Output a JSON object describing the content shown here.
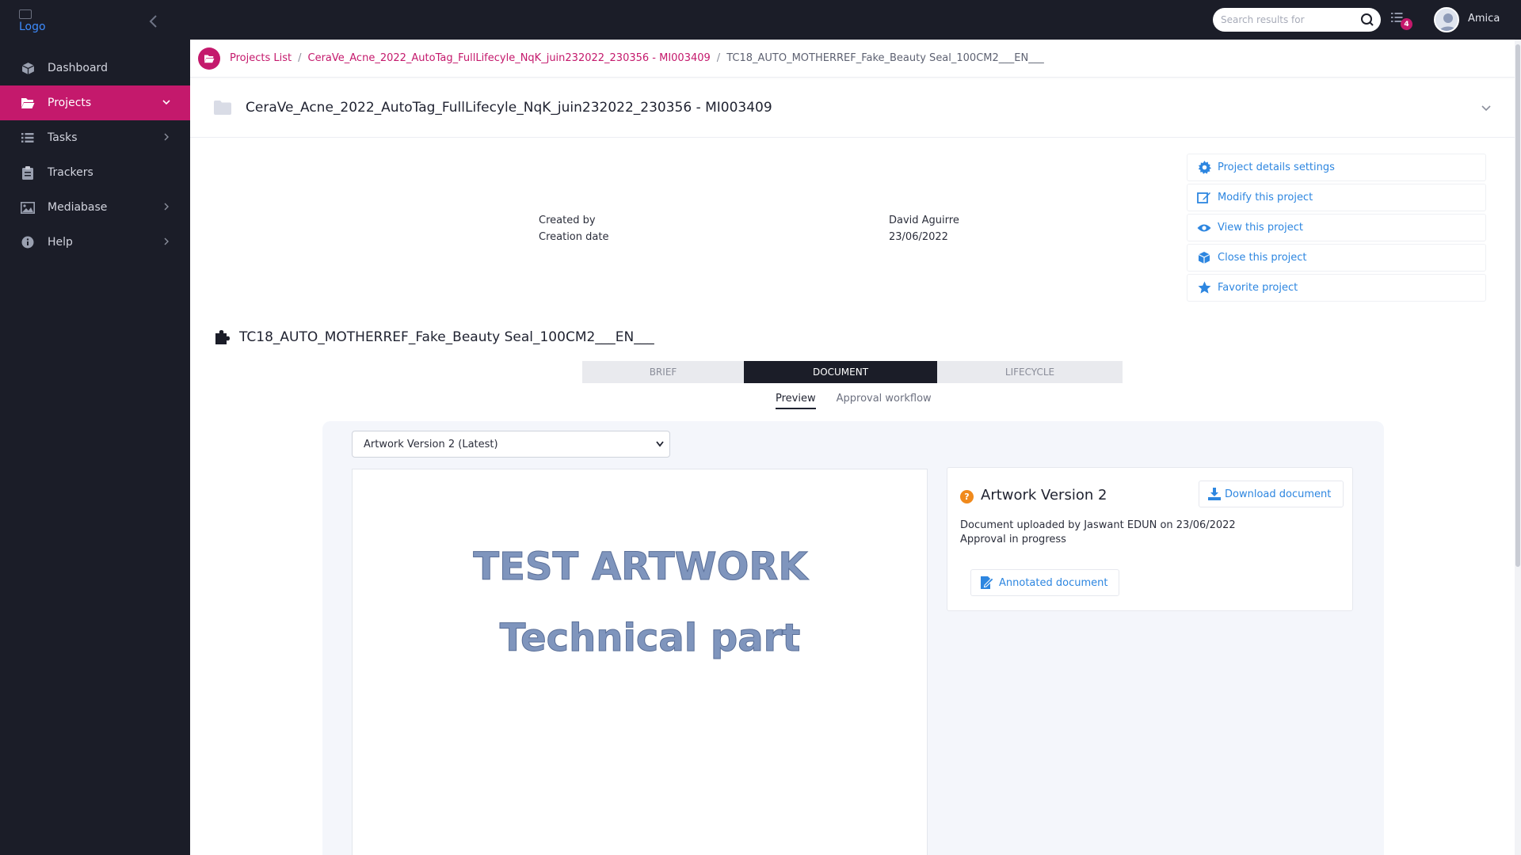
{
  "app": {
    "logo_alt": "Logo",
    "collapse_icon": "chevron-left-icon"
  },
  "sidebar": {
    "items": [
      {
        "label": "Dashboard",
        "icon": "cube-icon",
        "active": false,
        "has_chevron": false
      },
      {
        "label": "Projects",
        "icon": "folder-open-icon",
        "active": true,
        "has_chevron": true
      },
      {
        "label": "Tasks",
        "icon": "list-icon",
        "active": false,
        "has_chevron": true
      },
      {
        "label": "Trackers",
        "icon": "clipboard-icon",
        "active": false,
        "has_chevron": false
      },
      {
        "label": "Mediabase",
        "icon": "image-icon",
        "active": false,
        "has_chevron": true
      },
      {
        "label": "Help",
        "icon": "info-icon",
        "active": false,
        "has_chevron": true
      }
    ]
  },
  "topbar": {
    "search_placeholder": "Search results for",
    "tasks_count": "4",
    "user_name": "Amica"
  },
  "breadcrumb": {
    "root": "Projects List",
    "project": "CeraVe_Acne_2022_AutoTag_FullLifecyle_NqK_juin232022_230356 - MI003409",
    "current": "TC18_AUTO_MOTHERREF_Fake_Beauty Seal_100CM2___EN___",
    "sep": "/"
  },
  "project": {
    "title": "CeraVe_Acne_2022_AutoTag_FullLifecyle_NqK_juin232022_230356 - MI003409",
    "created_by_label": "Created by",
    "creation_date_label": "Creation date",
    "created_by": "David Aguirre",
    "creation_date": "23/06/2022"
  },
  "actions": [
    {
      "label": "Project details settings",
      "icon": "gear-icon"
    },
    {
      "label": "Modify this project",
      "icon": "edit-icon"
    },
    {
      "label": "View this project",
      "icon": "eye-icon"
    },
    {
      "label": "Close this project",
      "icon": "box-icon"
    },
    {
      "label": "Favorite project",
      "icon": "star-icon"
    }
  ],
  "item": {
    "title": "TC18_AUTO_MOTHERREF_Fake_Beauty Seal_100CM2___EN___",
    "icon": "puzzle-icon"
  },
  "tabs": [
    {
      "label": "BRIEF",
      "active": false
    },
    {
      "label": "DOCUMENT",
      "active": true
    },
    {
      "label": "LIFECYCLE",
      "active": false
    }
  ],
  "subtabs": [
    {
      "label": "Preview",
      "active": true
    },
    {
      "label": "Approval workflow",
      "active": false
    }
  ],
  "document": {
    "version_selected": "Artwork Version 2 (Latest)",
    "artwork_line1": "TEST ARTWORK",
    "artwork_line2": "Technical part",
    "info_title": "Artwork Version 2",
    "status_icon": "question-circle-icon",
    "download_label": "Download document",
    "uploaded_text": "Document uploaded by Jaswant EDUN on 23/06/2022",
    "status_text": "Approval in progress",
    "annotated_label": "Annotated document"
  },
  "colors": {
    "sidebar_bg": "#1b1d28",
    "accent": "#c4196c",
    "link_blue": "#2d86e0",
    "status_orange": "#f08a1d"
  }
}
